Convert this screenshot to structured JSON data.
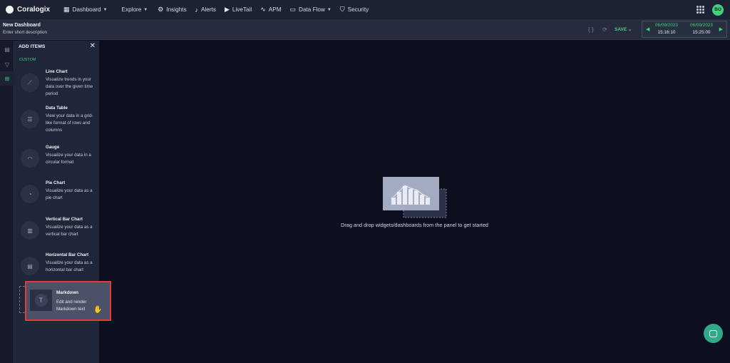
{
  "app": {
    "brand": "Coralogix",
    "logo_icon": "coralogix-logo-icon"
  },
  "nav": {
    "items": [
      {
        "label": "Dashboard",
        "icon": "dashboard-grid-icon",
        "dropdown": true
      },
      {
        "label": "Explore",
        "icon": "",
        "dropdown": true
      },
      {
        "label": "Insights",
        "icon": "gear-icon",
        "dropdown": false
      },
      {
        "label": "Alerts",
        "icon": "bell-icon",
        "dropdown": false
      },
      {
        "label": "LiveTail",
        "icon": "play-icon",
        "dropdown": false
      },
      {
        "label": "APM",
        "icon": "apm-icon",
        "dropdown": false
      },
      {
        "label": "Data Flow",
        "icon": "folder-icon",
        "dropdown": true
      },
      {
        "label": "Security",
        "icon": "shield-icon",
        "dropdown": false
      }
    ],
    "avatar_initials": "BO"
  },
  "dashboard": {
    "title": "New Dashboard",
    "description_placeholder": "Enter short description",
    "save_label": "SAVE",
    "time_from": {
      "date": "06/09/2023",
      "time": "15:16:10"
    },
    "time_to": {
      "date": "06/09/2023",
      "time": "15:25:00"
    }
  },
  "panel": {
    "title": "ADD ITEMS",
    "section": "CUSTOM",
    "items": [
      {
        "title": "Line Chart",
        "desc": "Visualize trends in your data over the given time period",
        "icon": "line-chart-icon"
      },
      {
        "title": "Data Table",
        "desc": "View your data in a grid-like format of rows and columns",
        "icon": "table-icon"
      },
      {
        "title": "Gauge",
        "desc": "Visualize your data in a circular format",
        "icon": "gauge-icon"
      },
      {
        "title": "Pie Chart",
        "desc": "Visualize your data as a pie chart",
        "icon": "pie-chart-icon"
      },
      {
        "title": "Vertical Bar Chart",
        "desc": "Visualize your data as a vertical bar chart",
        "icon": "vertical-bar-icon"
      },
      {
        "title": "Horizontal Bar Chart",
        "desc": "Visualize your data as a horizontal bar chart",
        "icon": "horizontal-bar-icon"
      }
    ],
    "dragging": {
      "title": "Markdown",
      "desc": "Edit and render Markdown text",
      "icon": "markdown-icon"
    }
  },
  "canvas": {
    "empty_message": "Drag and drop widgets/dashboards from the panel to get started"
  },
  "colors": {
    "accent": "#3ed17e",
    "highlight": "#e23a3a",
    "nav_bg": "#1d2232",
    "canvas_bg": "#0e0f1e"
  }
}
